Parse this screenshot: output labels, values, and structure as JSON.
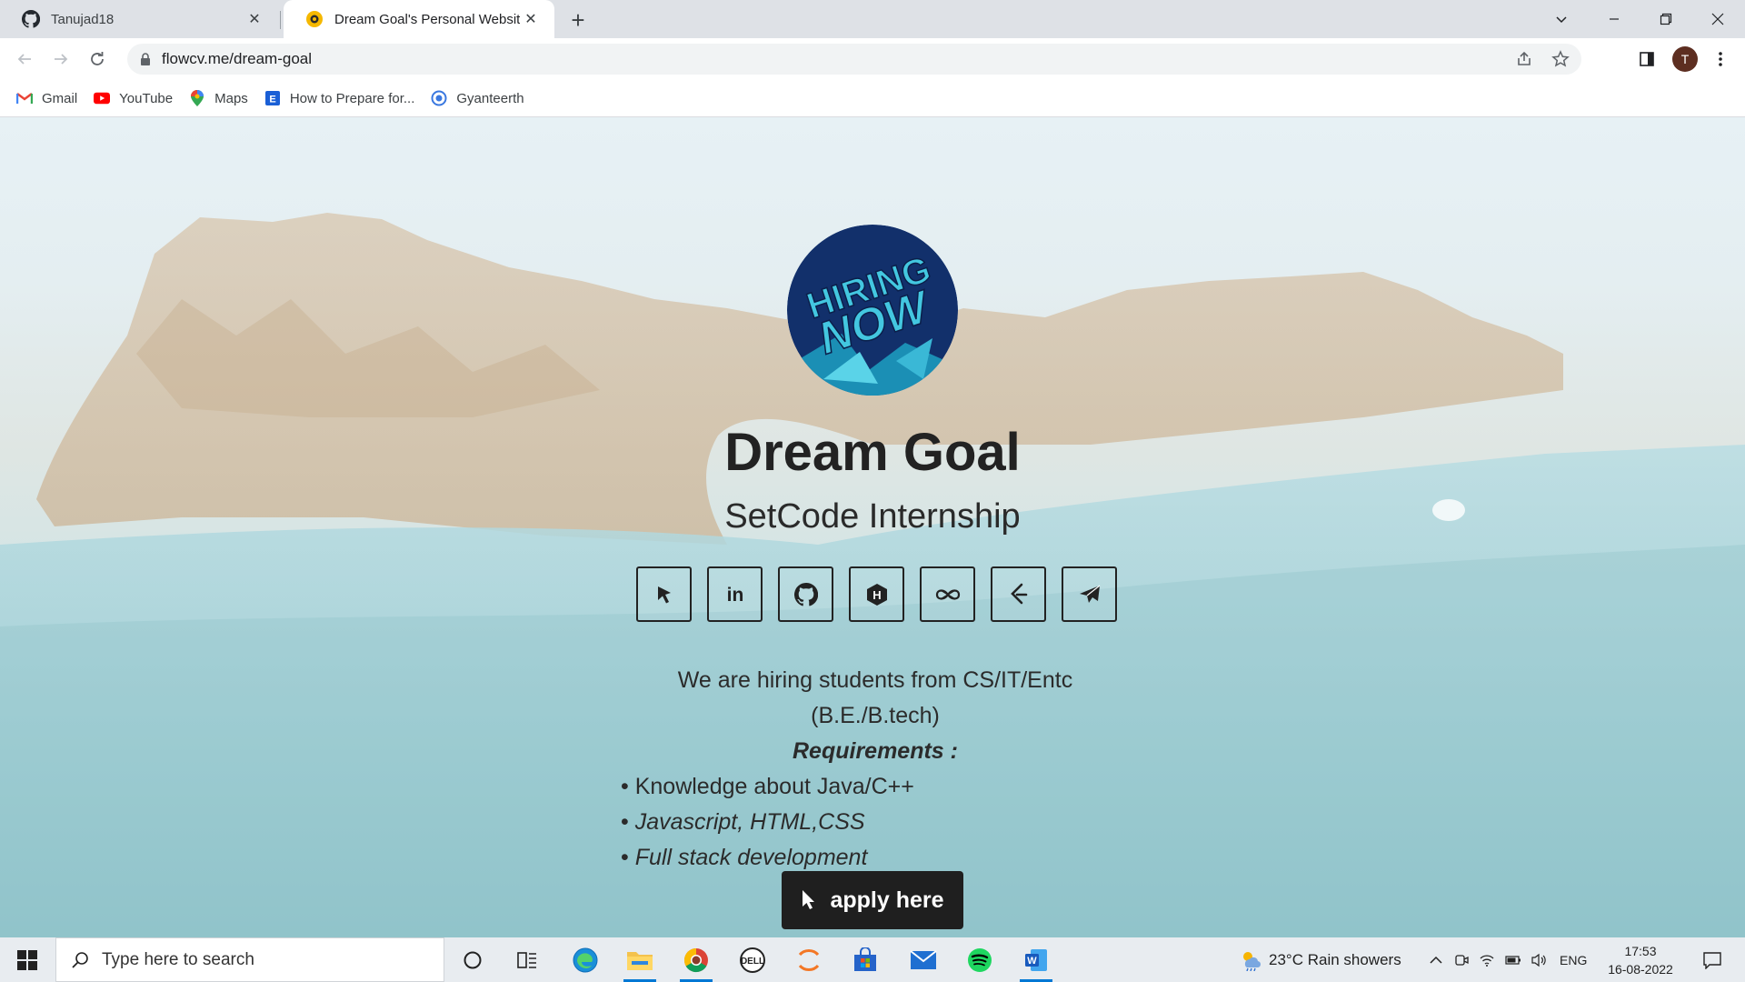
{
  "browser": {
    "tabs": [
      {
        "title": "Tanujad18",
        "icon": "github-icon",
        "active": false
      },
      {
        "title": "Dream Goal's Personal Website",
        "icon": "flowcv-icon",
        "active": true
      }
    ],
    "url": "flowcv.me/dream-goal",
    "profile_initial": "T",
    "bookmarks": [
      {
        "label": "Gmail",
        "icon": "gmail-icon"
      },
      {
        "label": "YouTube",
        "icon": "youtube-icon"
      },
      {
        "label": "Maps",
        "icon": "maps-icon"
      },
      {
        "label": "How to Prepare for...",
        "icon": "bookmark-e-icon"
      },
      {
        "label": "Gyanteerth",
        "icon": "gyanteerth-icon"
      }
    ]
  },
  "profile": {
    "image_text_1": "HIRING",
    "image_text_2": "NOW",
    "name": "Dream Goal",
    "subtitle": "SetCode Internship",
    "social_icons": [
      "pointer-icon",
      "linkedin-icon",
      "github-icon",
      "hashnode-icon",
      "codechef-icon",
      "leetcode-icon",
      "telegram-icon"
    ],
    "linkedin_label": "in",
    "hashnode_label": "H"
  },
  "description": {
    "intro": "We are hiring students from CS/IT/Entc (B.E./B.tech)",
    "requirements_heading": "Requirements :",
    "bullet": "•",
    "items": [
      "Knowledge about Java/C++",
      "Javascript, HTML,CSS",
      "Full stack development"
    ]
  },
  "cta": {
    "label": "apply here"
  },
  "taskbar": {
    "search_placeholder": "Type here to search",
    "weather": "23°C  Rain showers",
    "language": "ENG",
    "time": "17:53",
    "date": "16-08-2022"
  },
  "colors": {
    "button_bg": "#1f1f1f",
    "accent": "#0078d4",
    "avatar_bg": "#5d2e21"
  }
}
